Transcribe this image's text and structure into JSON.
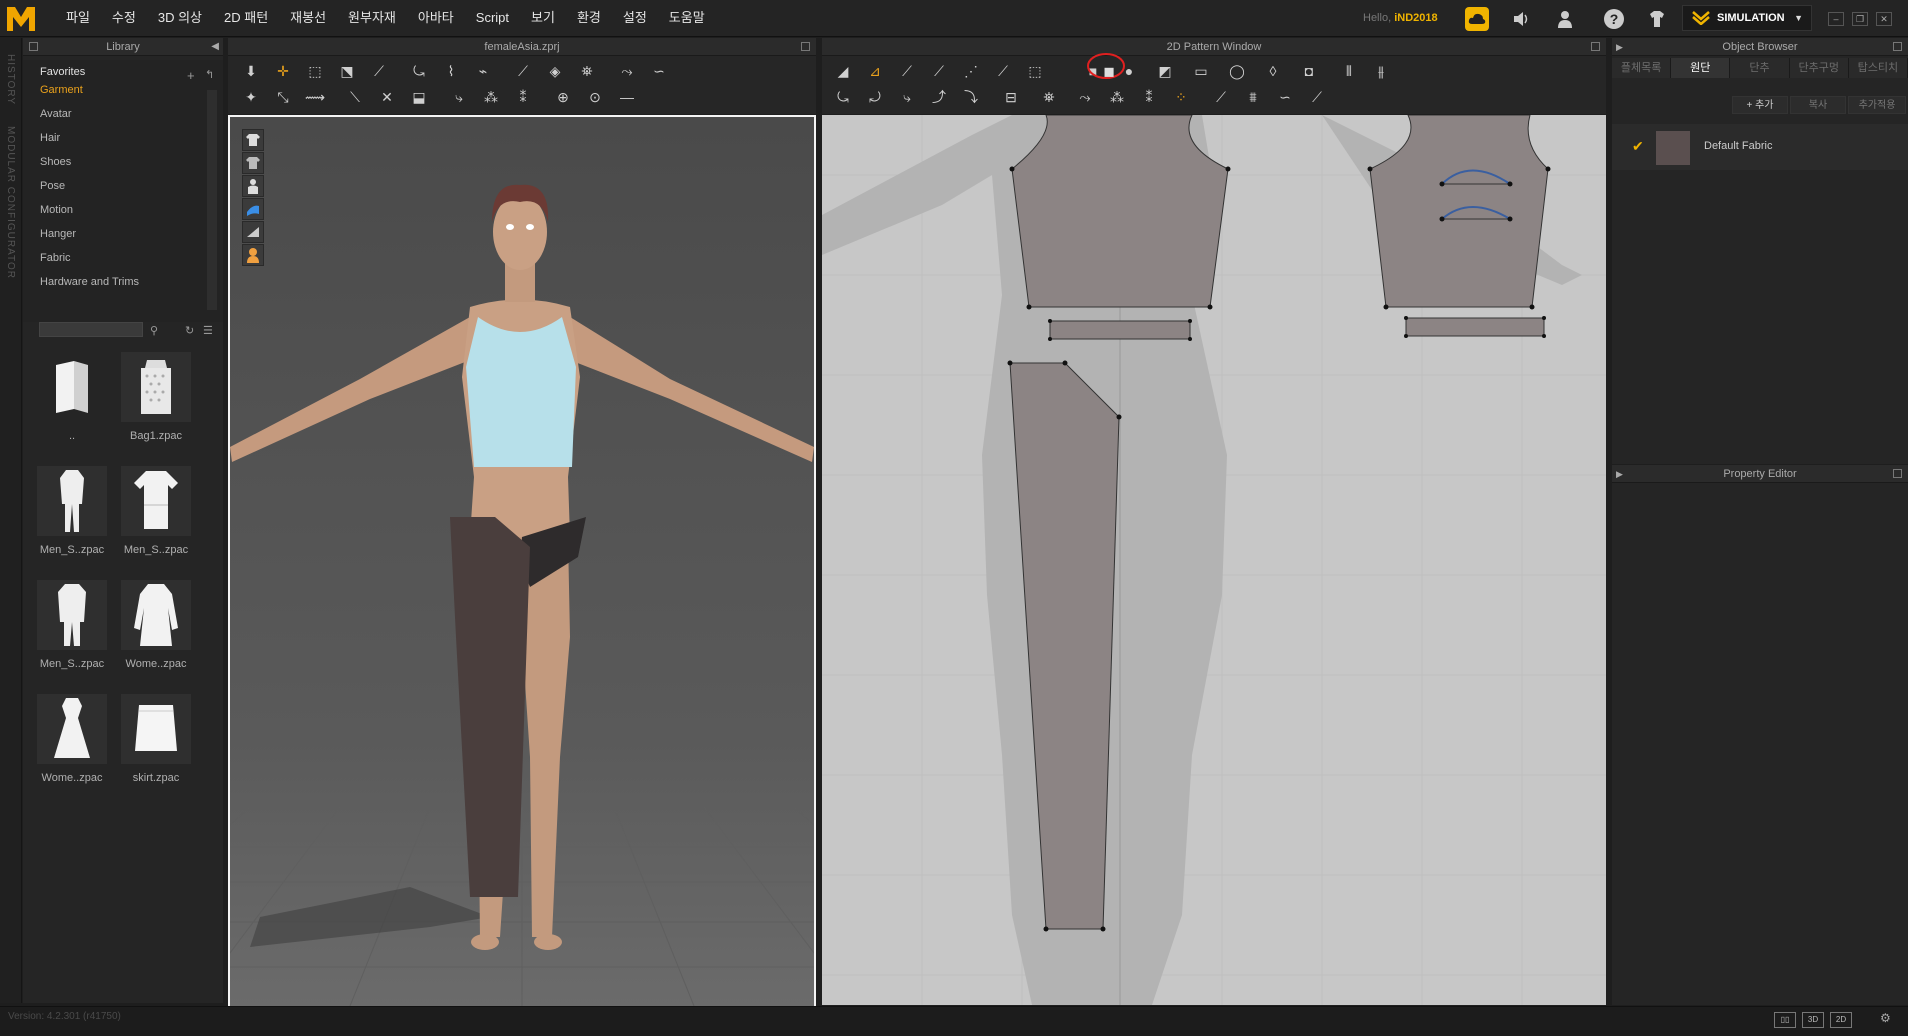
{
  "menubar": {
    "items": [
      "파일",
      "수정",
      "3D 의상",
      "2D 패턴",
      "재봉선",
      "원부자재",
      "아바타",
      "Script",
      "보기",
      "환경",
      "설정",
      "도움말"
    ],
    "hello_prefix": "Hello,",
    "user": "iND2018",
    "simulation_label": "SIMULATION"
  },
  "left_strip": {
    "history": "HISTORY",
    "modular": "MODULAR CONFIGURATOR"
  },
  "library": {
    "title": "Library",
    "tree": [
      "Favorites",
      "Garment",
      "Avatar",
      "Hair",
      "Shoes",
      "Pose",
      "Motion",
      "Hanger",
      "Fabric",
      "Hardware and Trims"
    ],
    "active_item": "Garment",
    "items": [
      {
        "label": "..",
        "icon": "folder-icon"
      },
      {
        "label": "Bag1.zpac",
        "icon": "bag-icon"
      },
      {
        "label": "Men_S..zpac",
        "icon": "suit-icon"
      },
      {
        "label": "Men_S..zpac",
        "icon": "shirt-icon"
      },
      {
        "label": "Men_S..zpac",
        "icon": "suit-jacket-icon"
      },
      {
        "label": "Wome..zpac",
        "icon": "coat-icon"
      },
      {
        "label": "Wome..zpac",
        "icon": "dress-icon"
      },
      {
        "label": "skirt.zpac",
        "icon": "skirt-icon"
      }
    ]
  },
  "view3d": {
    "title": "femaleAsia.zprj"
  },
  "view2d": {
    "title": "2D Pattern Window"
  },
  "object_browser": {
    "title": "Object Browser",
    "tabs": [
      "플체목록",
      "원단",
      "단추",
      "단추구멍",
      "탑스티치"
    ],
    "active_tab": "원단",
    "buttons": [
      "+ 추가",
      "복사",
      "추가적용"
    ],
    "fabric_name": "Default Fabric",
    "fabric_color": "#5a4f4f"
  },
  "property_editor": {
    "title": "Property Editor"
  },
  "status": {
    "version": "Version: 4.2.301 (r41750)",
    "btn_3d": "3D",
    "btn_2d": "2D"
  },
  "colors": {
    "accent": "#e9a11c",
    "pattern_fill": "#8c8484",
    "highlight_circle": "#e02020",
    "garment_top": "#b7e0ea",
    "panel_dark": "#4a3e3d"
  }
}
